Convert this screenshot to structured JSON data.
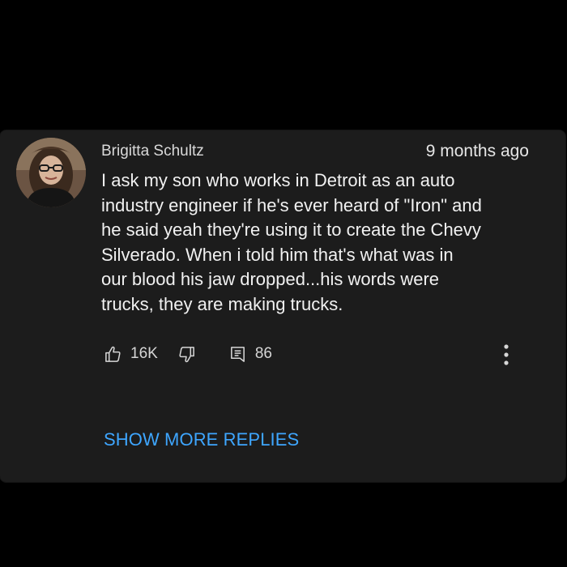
{
  "comment": {
    "author": "Brigitta Schultz",
    "timestamp": "9 months ago",
    "text": "I ask my son who works in Detroit as an auto\nindustry engineer if he's ever heard of \"Iron\" and\nhe said yeah they're using it to create the Chevy\nSilverado. When i told him that's what was in\nour blood his jaw dropped...his words were\ntrucks, they are making trucks.",
    "like_count": "16K",
    "reply_count": "86",
    "avatar_icon": "user-avatar",
    "like_icon": "thumbs-up-icon",
    "dislike_icon": "thumbs-down-icon",
    "reply_icon": "reply-icon",
    "more_icon": "more-vertical-icon"
  },
  "replies": {
    "show_more_label": "SHOW MORE REPLIES"
  },
  "colors": {
    "background": "#000000",
    "card": "#1c1c1c",
    "text": "#f1f1f1",
    "link": "#3ea6ff"
  }
}
